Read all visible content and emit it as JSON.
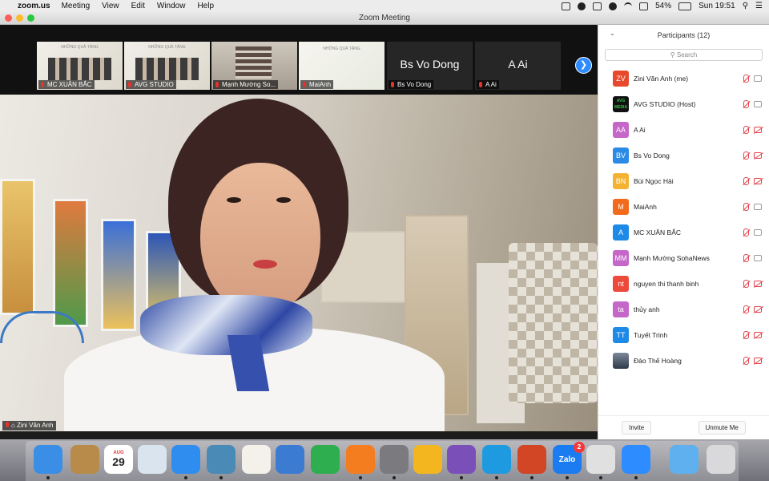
{
  "menubar": {
    "app_name": "zoom.us",
    "menus": [
      "Meeting",
      "View",
      "Edit",
      "Window",
      "Help"
    ],
    "battery": "54%",
    "clock": "Sun 19:51"
  },
  "window": {
    "title": "Zoom Meeting"
  },
  "thumbnails": [
    {
      "label": "MC XUÂN BẮC",
      "kind": "poster",
      "poster_title": "NHỮNG QUÀ TẶNG"
    },
    {
      "label": "AVG STUDIO",
      "kind": "poster",
      "poster_title": "NHỮNG QUÀ TẶNG"
    },
    {
      "label": "Mạnh Mường So...",
      "kind": "shelf"
    },
    {
      "label": "MaiAnh",
      "kind": "mai",
      "poster_title": "NHỮNG QUÀ TẶNG"
    },
    {
      "label": "Bs Vo Dong",
      "kind": "name",
      "big_name": "Bs Vo Dong"
    },
    {
      "label": "A Ai",
      "kind": "name",
      "big_name": "A Ai"
    }
  ],
  "main_video": {
    "name": "Zini Văn Anh"
  },
  "participants": {
    "header": "Participants (12)",
    "search_placeholder": "Search",
    "list": [
      {
        "initials": "ZV",
        "name": "Zini Văn Anh (me)",
        "color": "#e8492d",
        "avatar": "text",
        "mic_muted": true,
        "cam_off": false
      },
      {
        "initials": "AVG MEDIA",
        "name": "AVG STUDIO (Host)",
        "color": "#111111",
        "avatar": "logo",
        "mic_muted": true,
        "cam_off": false
      },
      {
        "initials": "AA",
        "name": "A Ai",
        "color": "#c567c9",
        "avatar": "text",
        "mic_muted": true,
        "cam_off": true
      },
      {
        "initials": "BV",
        "name": "Bs Vo Dong",
        "color": "#2a8ae6",
        "avatar": "text",
        "mic_muted": true,
        "cam_off": true
      },
      {
        "initials": "BN",
        "name": "Bùi Ngọc Hải",
        "color": "#f4b233",
        "avatar": "text",
        "mic_muted": true,
        "cam_off": true
      },
      {
        "initials": "M",
        "name": "MaiAnh",
        "color": "#f26a1b",
        "avatar": "text",
        "mic_muted": true,
        "cam_off": false
      },
      {
        "initials": "A",
        "name": "MC XUÂN BẮC",
        "color": "#1e8ae8",
        "avatar": "text",
        "mic_muted": true,
        "cam_off": false
      },
      {
        "initials": "MM",
        "name": "Mạnh Mường SohaNews",
        "color": "#c567c9",
        "avatar": "text",
        "mic_muted": true,
        "cam_off": false
      },
      {
        "initials": "nt",
        "name": "nguyen thi thanh binh",
        "color": "#ec4a3b",
        "avatar": "text",
        "mic_muted": true,
        "cam_off": true
      },
      {
        "initials": "ta",
        "name": "thủy anh",
        "color": "#c567c9",
        "avatar": "text",
        "mic_muted": true,
        "cam_off": true
      },
      {
        "initials": "TT",
        "name": "Tuyết Trinh",
        "color": "#1e8ae8",
        "avatar": "text",
        "mic_muted": true,
        "cam_off": true
      },
      {
        "initials": "",
        "name": "Đào Thế Hoàng",
        "color": "#445566",
        "avatar": "photo",
        "mic_muted": true,
        "cam_off": true
      }
    ],
    "invite_label": "Invite",
    "unmute_label": "Unmute Me"
  },
  "dock": {
    "calendar_month": "AUG",
    "calendar_day": "29",
    "zalo_label": "Zalo",
    "zalo_badge": "2",
    "icons": [
      {
        "name": "finder-icon",
        "color": "#3a8ee6"
      },
      {
        "name": "contacts-icon",
        "color": "#b88b4a"
      },
      {
        "name": "calendar-icon",
        "color": "#ffffff"
      },
      {
        "name": "preview-icon",
        "color": "#d9e4ef"
      },
      {
        "name": "safari-icon",
        "color": "#2f8df0"
      },
      {
        "name": "photos-icon",
        "color": "#4a8ab6"
      },
      {
        "name": "textedit-icon",
        "color": "#f3f1ea"
      },
      {
        "name": "keynote-icon",
        "color": "#3b7bd1"
      },
      {
        "name": "numbers-icon",
        "color": "#2fae4f"
      },
      {
        "name": "books-icon",
        "color": "#f47d20"
      },
      {
        "name": "system-preferences-icon",
        "color": "#7b7b7f"
      },
      {
        "name": "outline-icon",
        "color": "#f4b61e"
      },
      {
        "name": "viber-icon",
        "color": "#7b4fb8"
      },
      {
        "name": "c-app-icon",
        "color": "#1e9be0"
      },
      {
        "name": "powerpoint-icon",
        "color": "#d24625"
      },
      {
        "name": "zalo-icon",
        "color": "#1b7bf1"
      },
      {
        "name": "chrome-icon",
        "color": "#e0e0e0"
      },
      {
        "name": "zoom-icon",
        "color": "#2d8cff"
      },
      {
        "name": "applications-folder-icon",
        "color": "#5eb1ee"
      },
      {
        "name": "trash-icon",
        "color": "#d9d9db"
      }
    ]
  }
}
